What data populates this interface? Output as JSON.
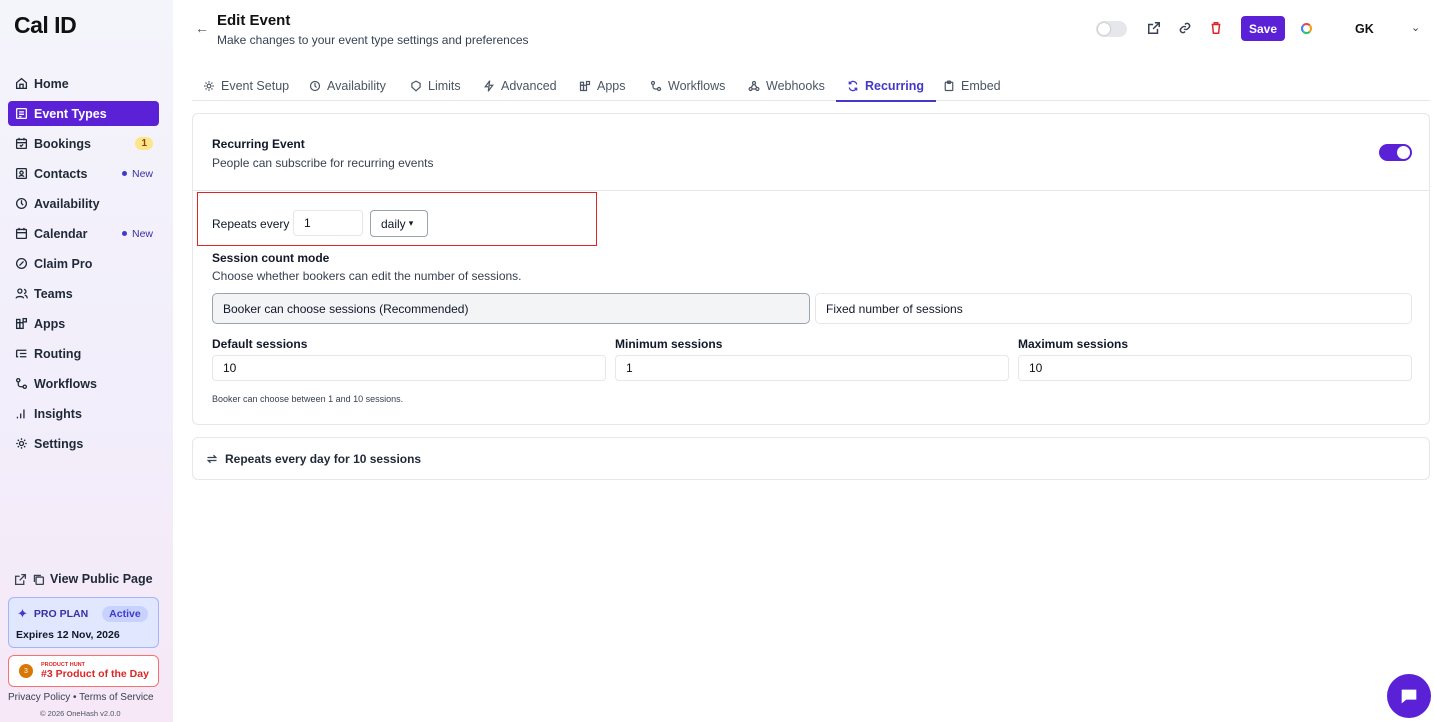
{
  "app": {
    "logo": "Cal ID"
  },
  "sidebar": {
    "items": [
      {
        "label": "Home",
        "icon": "home-icon"
      },
      {
        "label": "Event Types",
        "icon": "event-types-icon",
        "active": true
      },
      {
        "label": "Bookings",
        "icon": "calendar-check-icon",
        "badge": "1"
      },
      {
        "label": "Contacts",
        "icon": "contacts-icon",
        "tag": "New"
      },
      {
        "label": "Availability",
        "icon": "clock-icon"
      },
      {
        "label": "Calendar",
        "icon": "calendar-icon",
        "tag": "New"
      },
      {
        "label": "Claim Pro",
        "icon": "claim-icon"
      },
      {
        "label": "Teams",
        "icon": "users-icon"
      },
      {
        "label": "Apps",
        "icon": "apps-icon"
      },
      {
        "label": "Routing",
        "icon": "routing-icon"
      },
      {
        "label": "Workflows",
        "icon": "workflows-icon"
      },
      {
        "label": "Insights",
        "icon": "insights-icon"
      },
      {
        "label": "Settings",
        "icon": "gear-icon"
      }
    ],
    "public_page": "View Public Page",
    "plan": {
      "name": "PRO PLAN",
      "status": "Active",
      "expires": "Expires 12 Nov, 2026"
    },
    "product_hunt": {
      "small": "PRODUCT HUNT",
      "label": "#3 Product of the Day"
    },
    "footer": {
      "privacy": "Privacy Policy",
      "separator": "•",
      "terms": "Terms of Service",
      "copyright": "© 2026 OneHash v2.0.0"
    }
  },
  "header": {
    "title": "Edit Event",
    "subtitle": "Make changes to your event type settings and preferences",
    "save_label": "Save",
    "avatar_initials": "GK"
  },
  "tabs": [
    {
      "label": "Event Setup",
      "icon": "gear-icon"
    },
    {
      "label": "Availability",
      "icon": "clock-icon"
    },
    {
      "label": "Limits",
      "icon": "shield-icon"
    },
    {
      "label": "Advanced",
      "icon": "bolt-icon"
    },
    {
      "label": "Apps",
      "icon": "apps-icon"
    },
    {
      "label": "Workflows",
      "icon": "workflows-icon"
    },
    {
      "label": "Webhooks",
      "icon": "webhook-icon"
    },
    {
      "label": "Recurring",
      "icon": "repeat-icon",
      "active": true
    },
    {
      "label": "Embed",
      "icon": "clipboard-icon"
    }
  ],
  "recurring": {
    "title": "Recurring Event",
    "description": "People can subscribe for recurring events",
    "enabled": true,
    "repeats_label": "Repeats every",
    "interval_value": "1",
    "frequency": "daily",
    "session_mode_title": "Session count mode",
    "session_mode_desc": "Choose whether bookers can edit the number of sessions.",
    "option_booker": "Booker can choose sessions (Recommended)",
    "option_fixed": "Fixed number of sessions",
    "default_label": "Default sessions",
    "default_value": "10",
    "min_label": "Minimum sessions",
    "min_value": "1",
    "max_label": "Maximum sessions",
    "max_value": "10",
    "hint": "Booker can choose between 1 and 10 sessions."
  },
  "summary": "Repeats every day for 10 sessions",
  "colors": {
    "accent": "#5b21d6",
    "highlight_border": "#dc2626"
  }
}
